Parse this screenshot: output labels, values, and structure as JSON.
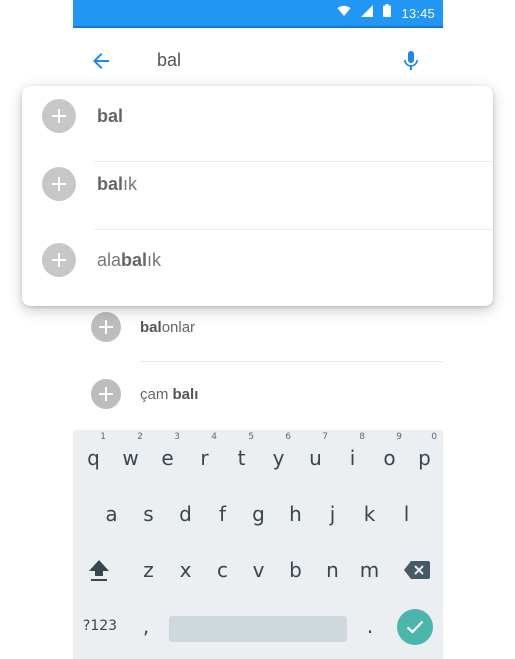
{
  "status_bar": {
    "time": "13:45",
    "icons": [
      "wifi-icon",
      "signal-icon",
      "battery-icon"
    ],
    "color": "#2196f3"
  },
  "search": {
    "query": "bal",
    "back_icon": "arrow-back-icon",
    "mic_icon": "mic-icon",
    "accent": "#1e88e5"
  },
  "popup_suggestions": [
    {
      "pre": "",
      "bold": "bal",
      "post": ""
    },
    {
      "pre": "",
      "bold": "bal",
      "post": "ık"
    },
    {
      "pre": "ala",
      "bold": "bal",
      "post": "ık"
    }
  ],
  "background_suggestions": [
    {
      "pre": "",
      "bold": "bal",
      "post": "onlar"
    },
    {
      "pre": "çam ",
      "bold": "balı",
      "post": ""
    }
  ],
  "keyboard": {
    "row1": [
      {
        "key": "q",
        "hint": "1"
      },
      {
        "key": "w",
        "hint": "2"
      },
      {
        "key": "e",
        "hint": "3"
      },
      {
        "key": "r",
        "hint": "4"
      },
      {
        "key": "t",
        "hint": "5"
      },
      {
        "key": "y",
        "hint": "6"
      },
      {
        "key": "u",
        "hint": "7"
      },
      {
        "key": "i",
        "hint": "8"
      },
      {
        "key": "o",
        "hint": "9"
      },
      {
        "key": "p",
        "hint": "0"
      }
    ],
    "row2": [
      "a",
      "s",
      "d",
      "f",
      "g",
      "h",
      "j",
      "k",
      "l"
    ],
    "row3": [
      "z",
      "x",
      "c",
      "v",
      "b",
      "n",
      "m"
    ],
    "symbols_label": "?123",
    "comma": ",",
    "period": ".",
    "shift_icon": "shift-icon",
    "backspace_icon": "backspace-icon",
    "enter_icon": "check-icon",
    "enter_color": "#4db6ac"
  }
}
